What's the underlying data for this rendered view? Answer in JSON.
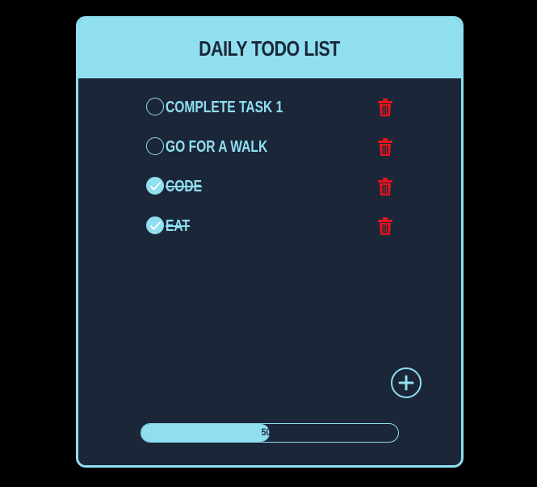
{
  "header": {
    "title": "DAILY TODO LIST"
  },
  "tasks": [
    {
      "label": "COMPLETE TASK 1",
      "done": false,
      "delete_icon": "trash-icon"
    },
    {
      "label": "GO FOR A WALK",
      "done": false,
      "delete_icon": "trash-icon"
    },
    {
      "label": "CODE",
      "done": true,
      "delete_icon": "trash-icon"
    },
    {
      "label": "EAT",
      "done": true,
      "delete_icon": "trash-icon"
    }
  ],
  "add_button": {
    "icon": "plus-icon"
  },
  "progress": {
    "label": "50%",
    "fraction": 0.5
  },
  "colors": {
    "accent": "#8fdff0",
    "background": "#1b2639",
    "delete": "#e8141c",
    "page": "#000000"
  }
}
